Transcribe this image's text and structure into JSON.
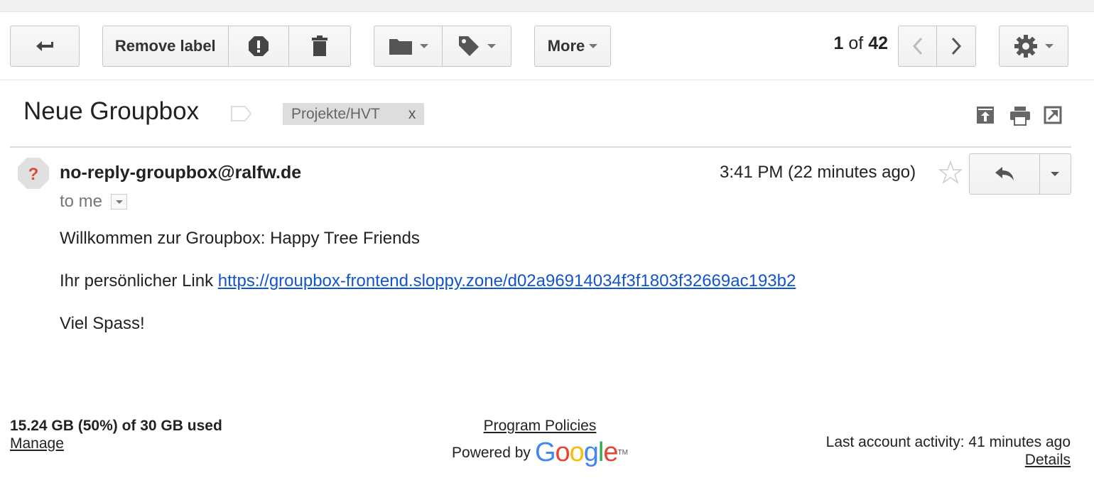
{
  "toolbar": {
    "remove_label": "Remove label",
    "more_label": "More",
    "pager": {
      "current": "1",
      "of_word": "of",
      "total": "42"
    }
  },
  "thread": {
    "subject": "Neue Groupbox",
    "label": "Projekte/HVT",
    "label_remove": "x"
  },
  "message": {
    "sender": "no-reply-groupbox@ralfw.de",
    "recipient": "to me",
    "time": "3:41 PM (22 minutes ago)",
    "body": {
      "line1": "Willkommen zur Groupbox: Happy Tree Friends",
      "line2_prefix": "Ihr persönlicher Link ",
      "link": "https://groupbox-frontend.sloppy.zone/d02a96914034f3f1803f32669ac193b2",
      "line3": "Viel Spass!"
    }
  },
  "footer": {
    "storage": "15.24 GB (50%) of 30 GB used",
    "manage": "Manage",
    "policies": "Program Policies",
    "powered_by": "Powered by",
    "google": "Google",
    "tm": "TM",
    "last_activity": "Last account activity: 41 minutes ago",
    "details": "Details"
  },
  "colors": {
    "link": "#1155cc",
    "spam_icon": "#dd4b39",
    "google_blue": "#4285f4",
    "google_red": "#ea4335",
    "google_yellow": "#fbbc05",
    "google_green": "#34a853"
  },
  "icons": [
    "back-arrow-icon",
    "report-spam-icon",
    "trash-icon",
    "folder-icon",
    "tag-icon",
    "chevron-left-icon",
    "chevron-right-icon",
    "gear-icon",
    "label-outline-icon",
    "archive-up-icon",
    "print-icon",
    "popout-icon",
    "unknown-sender-icon",
    "star-icon",
    "reply-icon"
  ]
}
